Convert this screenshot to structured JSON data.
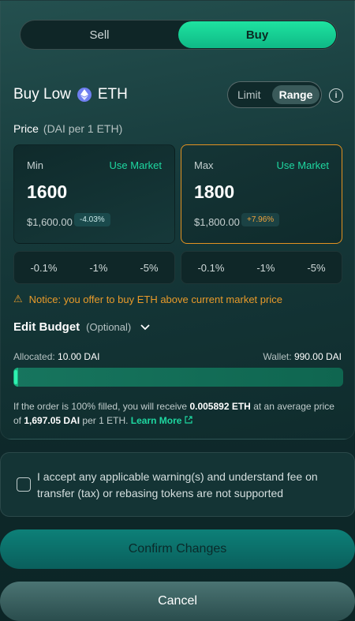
{
  "toggle": {
    "sell_label": "Sell",
    "buy_label": "Buy",
    "selected": "Buy"
  },
  "heading": {
    "prefix": "Buy Low",
    "token": "ETH",
    "token_icon": "eth-icon"
  },
  "mode": {
    "limit_label": "Limit",
    "range_label": "Range",
    "selected": "Range"
  },
  "price": {
    "label": "Price",
    "unit": "(DAI per 1 ETH)"
  },
  "min_card": {
    "label": "Min",
    "use_market": "Use Market",
    "value": "1600",
    "usd": "$1,600.00",
    "badge": "-4.03%"
  },
  "max_card": {
    "label": "Max",
    "use_market": "Use Market",
    "value": "1800",
    "usd": "$1,800.00",
    "badge": "+7.96%"
  },
  "min_pct": [
    "-0.1%",
    "-1%",
    "-5%"
  ],
  "max_pct": [
    "-0.1%",
    "-1%",
    "-5%"
  ],
  "notice": "Notice: you offer to buy ETH above current market price",
  "budget": {
    "title": "Edit Budget",
    "optional": "(Optional)"
  },
  "allocated": {
    "label": "Allocated:",
    "value": "10.00 DAI"
  },
  "wallet": {
    "label": "Wallet:",
    "value": "990.00 DAI"
  },
  "budget_fraction": 0.01,
  "fill_note": {
    "part1": "If the order is 100% filled, you will receive",
    "amount": "0.005892 ETH",
    "part2": "at an average price of",
    "avg_price": "1,697.05 DAI",
    "part3": "per 1 ETH.",
    "link": "Learn More"
  },
  "accept": "I accept any applicable warning(s) and understand fee on transfer (tax) or rebasing tokens are not supported",
  "confirm_label": "Confirm Changes",
  "cancel_label": "Cancel",
  "colors": {
    "accent": "#1ed7a0",
    "warning": "#e89a2a"
  }
}
